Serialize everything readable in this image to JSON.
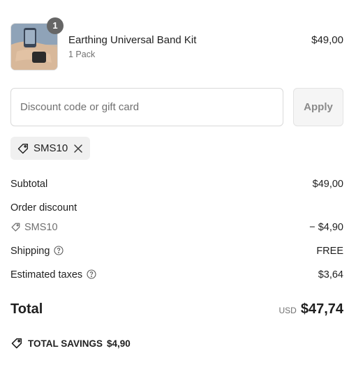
{
  "product": {
    "quantity": "1",
    "name": "Earthing Universal Band Kit",
    "variant": "1 Pack",
    "price": "$49,00"
  },
  "discount": {
    "placeholder": "Discount code or gift card",
    "apply_label": "Apply",
    "applied_code": "SMS10"
  },
  "summary": {
    "subtotal_label": "Subtotal",
    "subtotal_value": "$49,00",
    "order_discount_label": "Order discount",
    "discount_code": "SMS10",
    "discount_value": "− $4,90",
    "shipping_label": "Shipping",
    "shipping_value": "FREE",
    "taxes_label": "Estimated taxes",
    "taxes_value": "$3,64",
    "total_label": "Total",
    "total_currency": "USD",
    "total_value": "$47,74",
    "savings_label": "TOTAL SAVINGS",
    "savings_value": "$4,90"
  },
  "icons": {
    "tag": "tag-icon",
    "remove": "close-icon",
    "help": "question-circle-icon"
  },
  "colors": {
    "text": "#1f1f1f",
    "muted": "#707070",
    "chip_bg": "#f0f0f0",
    "badge_bg": "#666666"
  }
}
